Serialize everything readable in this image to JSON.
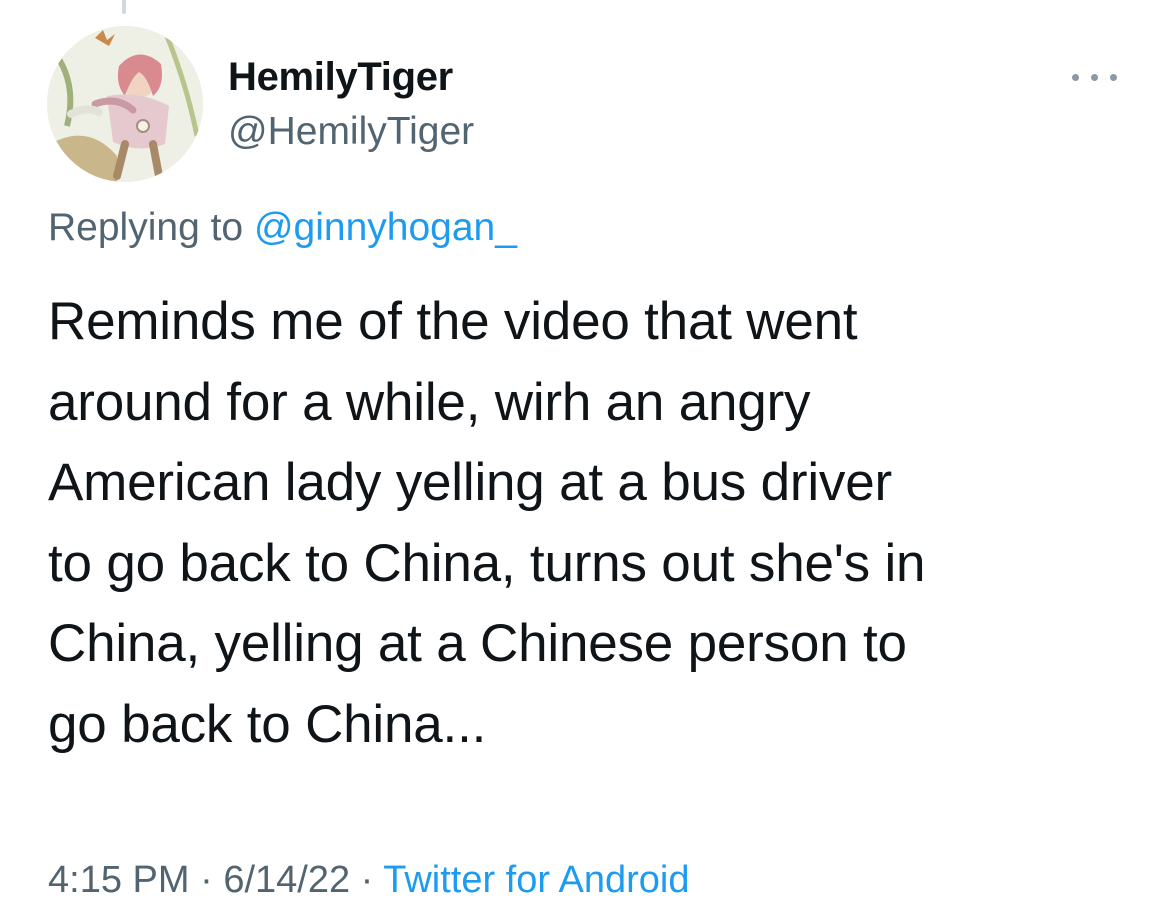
{
  "tweet": {
    "author": {
      "display_name": "HemilyTiger",
      "handle": "@HemilyTiger",
      "avatar": "illustrated-avatar"
    },
    "more_icon": "more-horizontal-icon",
    "reply": {
      "prefix": "Replying to ",
      "handle": "@ginnyhogan_"
    },
    "text": "Reminds me of the video that went\naround for a while, wirh an angry\nAmerican lady yelling at a bus driver\nto go back to China, turns out she's in\nChina, yelling at a Chinese person to\ngo back to China...",
    "time": "4:15 PM",
    "separator": " · ",
    "date": "6/14/22",
    "source": "Twitter for Android"
  },
  "colors": {
    "text": "#0f1419",
    "secondary": "#536471",
    "link": "#1d9bf0"
  }
}
